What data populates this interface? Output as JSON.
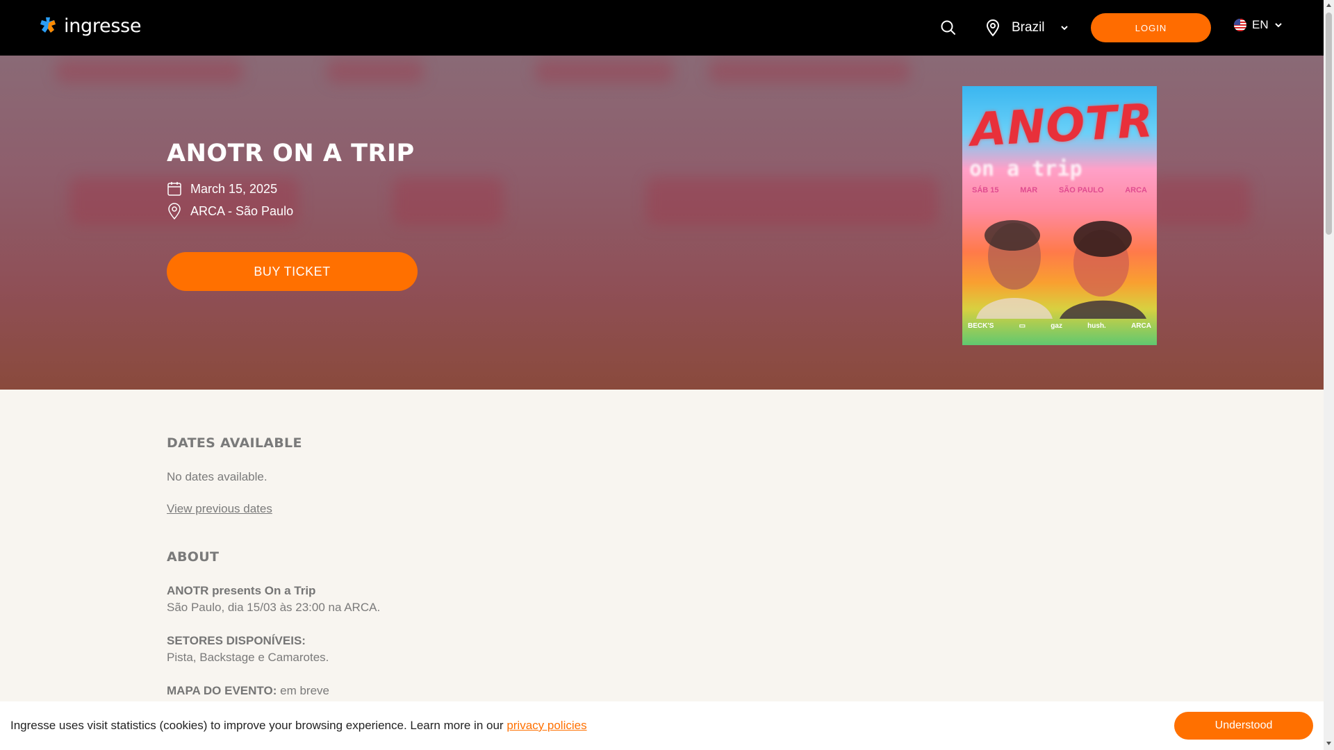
{
  "header": {
    "logo_text": "ingresse",
    "location": "Brazil",
    "login_label": "LOGIN",
    "language": "EN",
    "icons": [
      "search-icon",
      "location-pin-icon",
      "chevron-down-icon",
      "us-flag-icon"
    ]
  },
  "hero": {
    "title": "ANOTR ON A TRIP",
    "date": "March 15, 2025",
    "venue": "ARCA - São Paulo",
    "buy_label": "BUY TICKET",
    "poster": {
      "title": "ANOTR",
      "subtitle": "on a trip",
      "info": [
        "SÁB 15",
        "MAR",
        "SÃO PAULO",
        "ARCA"
      ],
      "sponsors": [
        "BECK'S",
        "▭",
        "gaz",
        "hush.",
        "ARCA"
      ]
    }
  },
  "dates": {
    "heading": "DATES AVAILABLE",
    "empty": "No dates available.",
    "previous_link": "View previous dates"
  },
  "about": {
    "heading": "ABOUT",
    "intro_bold": "ANOTR presents On a Trip",
    "intro_text": "São Paulo, dia 15/03 às 23:00 na ARCA.",
    "sectors_bold": "SETORES DISPONÍVEIS:",
    "sectors_text": "Pista, Backstage e Camarotes.",
    "map_bold": "MAPA DO EVENTO:",
    "map_text": "em breve"
  },
  "cookie": {
    "text": "Ingresse uses visit statistics (cookies) to improve your browsing experience. Learn more in our ",
    "link": "privacy policies",
    "button": "Understood"
  },
  "colors": {
    "accent": "#ff7000",
    "topbar": "#000000",
    "page_bg": "#f8f5f0"
  }
}
